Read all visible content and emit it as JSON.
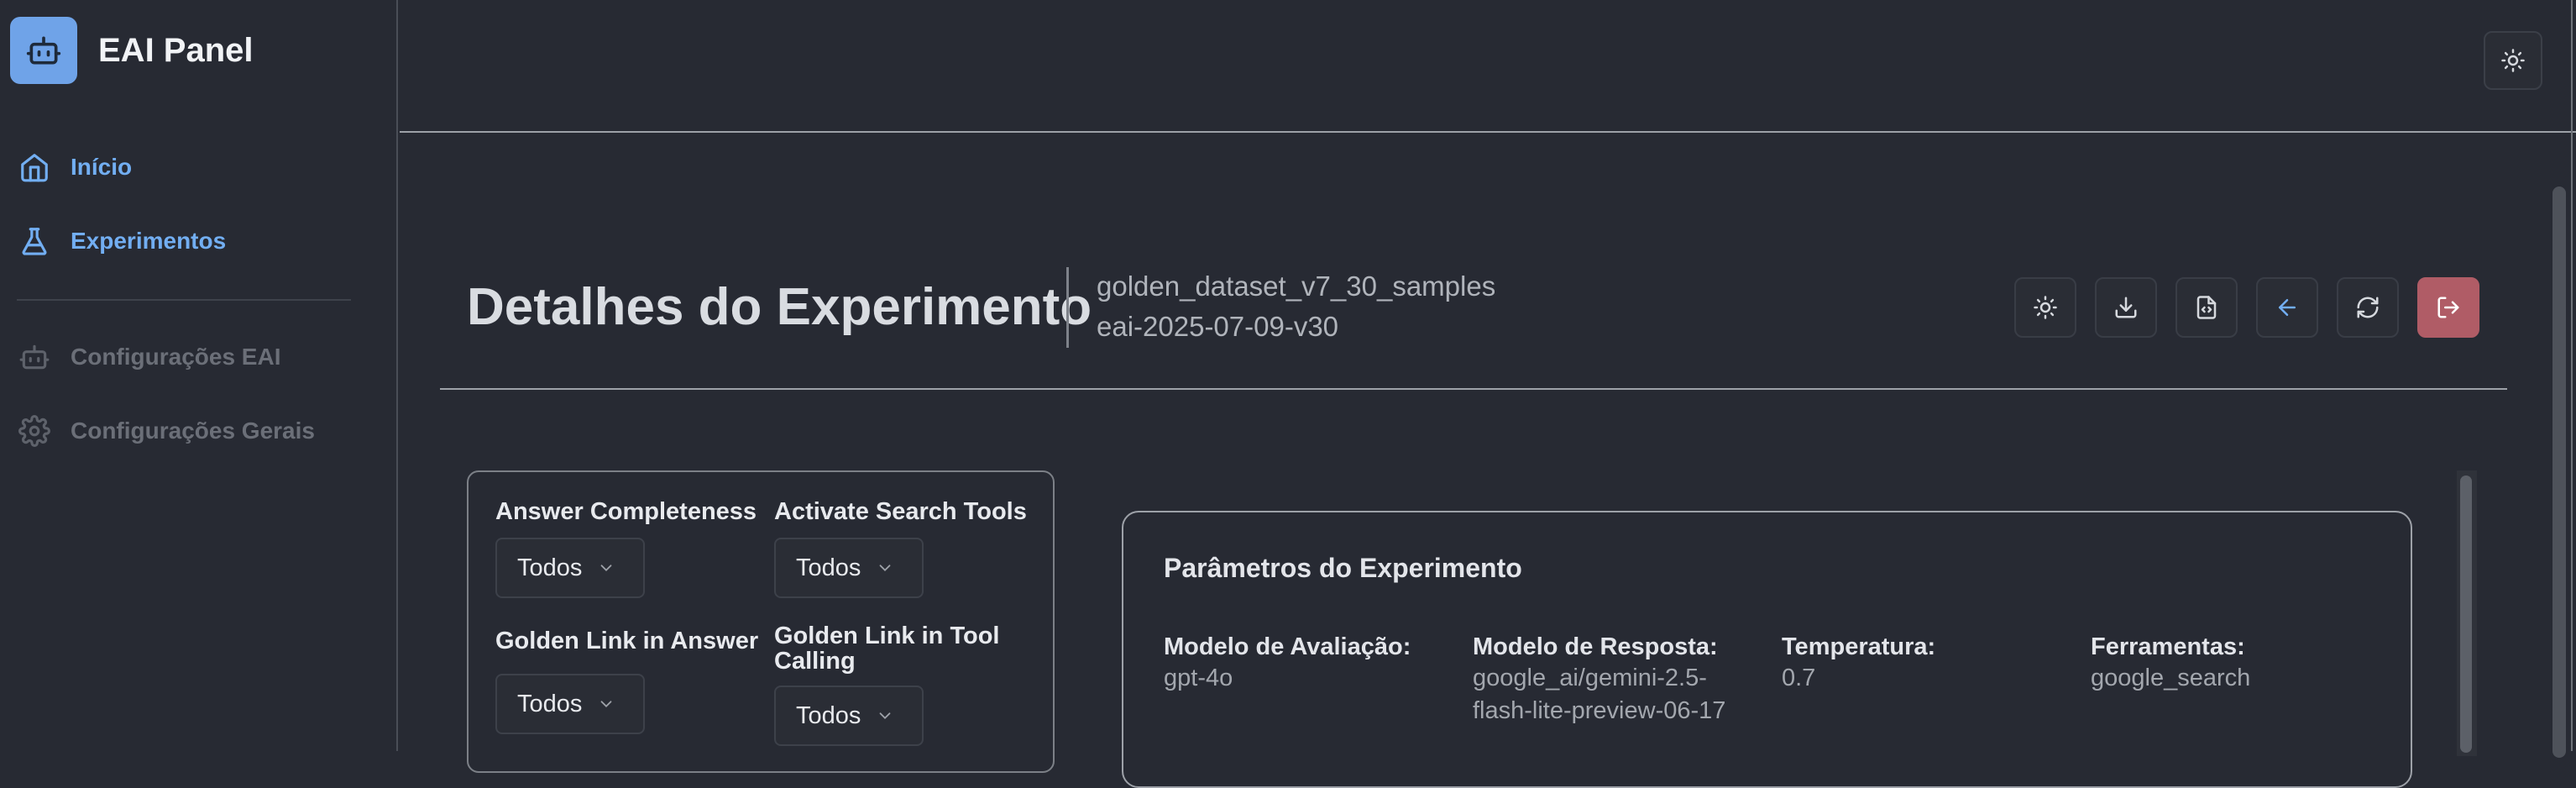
{
  "app": {
    "title": "EAI Panel",
    "logo_icon": "robot-icon",
    "accent": "#6fa3e8"
  },
  "sidebar": {
    "items": [
      {
        "label": "Início",
        "icon": "home-icon",
        "state": "active"
      },
      {
        "label": "Experimentos",
        "icon": "flask-icon",
        "state": "active"
      },
      {
        "label": "Configurações EAI",
        "icon": "robot-icon",
        "state": "disabled"
      },
      {
        "label": "Configurações Gerais",
        "icon": "gear-icon",
        "state": "disabled"
      }
    ]
  },
  "topbar": {
    "theme_icon": "sun-icon"
  },
  "header": {
    "title": "Detalhes do Experimento",
    "dataset": "golden_dataset_v7_30_samples",
    "experiment": "eai-2025-07-09-v30",
    "actions": [
      "sun-icon",
      "download-icon",
      "code-file-icon",
      "arrow-left-icon",
      "refresh-icon",
      "logout-icon"
    ]
  },
  "filters": [
    {
      "label": "Answer Completeness",
      "value": "Todos"
    },
    {
      "label": "Activate Search Tools",
      "value": "Todos"
    },
    {
      "label": "Golden Link in Answer",
      "value": "Todos"
    },
    {
      "label": "Golden Link in Tool Calling",
      "value": "Todos"
    }
  ],
  "parameters": {
    "title": "Parâmetros do Experimento",
    "items": [
      {
        "key": "Modelo de Avaliação:",
        "value": "gpt-4o"
      },
      {
        "key": "Modelo de Resposta:",
        "value": "google_ai/gemini-2.5-flash-lite-preview-06-17"
      },
      {
        "key": "Temperatura:",
        "value": "0.7"
      },
      {
        "key": "Ferramentas:",
        "value": "google_search"
      }
    ]
  },
  "colors": {
    "background": "#272a33",
    "active_link": "#72aef2",
    "danger": "#b05c66"
  }
}
